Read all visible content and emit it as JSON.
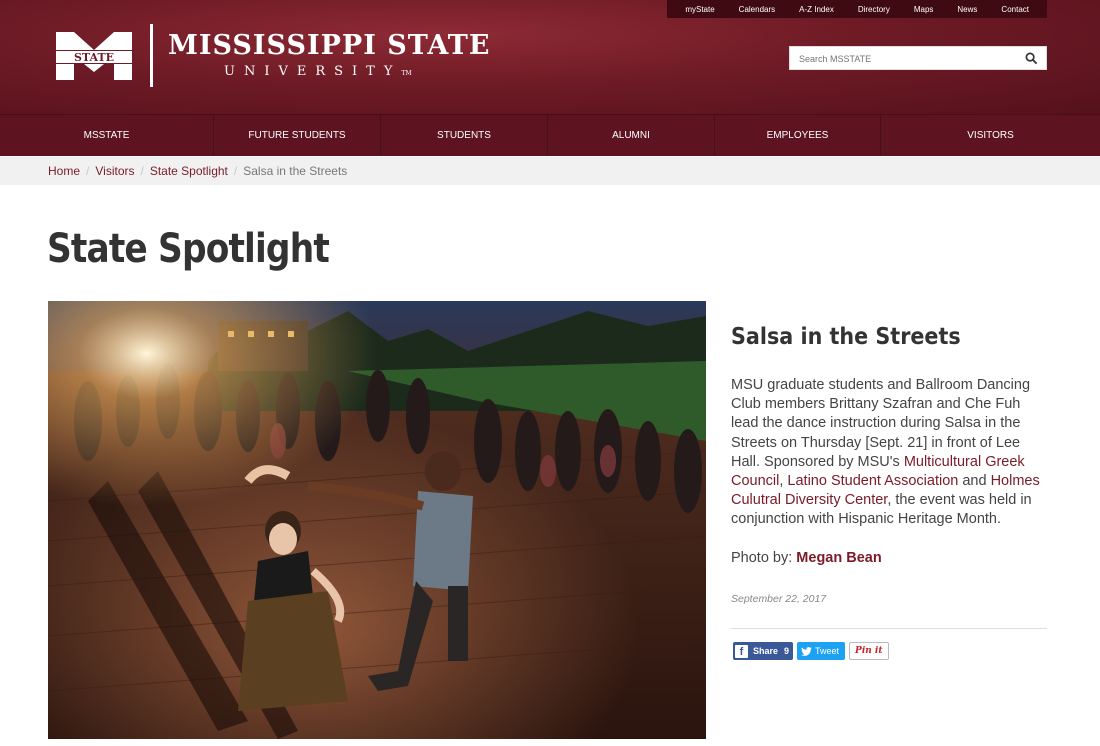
{
  "utility_nav": [
    "myState",
    "Calendars",
    "A-Z Index",
    "Directory",
    "Maps",
    "News",
    "Contact"
  ],
  "logo": {
    "mark_text": "STATE",
    "name": "MISSISSIPPI STATE",
    "sub": "UNIVERSITY",
    "tm": "TM"
  },
  "search": {
    "placeholder": "Search MSSTATE"
  },
  "main_nav": [
    "MSSTATE",
    "FUTURE STUDENTS",
    "STUDENTS",
    "ALUMNI",
    "EMPLOYEES",
    "VISITORS"
  ],
  "breadcrumb": {
    "items": [
      "Home",
      "Visitors",
      "State Spotlight"
    ],
    "current": "Salsa in the Streets"
  },
  "page_title": "State Spotlight",
  "article": {
    "title": "Salsa in the Streets",
    "body_1": "MSU graduate students and Ballroom Dancing Club members Brittany Szafran and Che Fuh lead the dance instruction during Salsa in the Streets on Thursday [Sept. 21] in front of Lee Hall. Sponsored by MSU's ",
    "link_1": "Multicultural Greek Council",
    "body_2": ", ",
    "link_2": "Latino Student Association",
    "body_3": " and ",
    "link_3": "Holmes Culutral Diversity Center",
    "body_4": ", the event was held in conjunction with Hispanic Heritage Month.",
    "photo_by_label": "Photo by: ",
    "photo_by_name": "Megan Bean",
    "date": "September 22, 2017"
  },
  "share": {
    "facebook_label": "Share",
    "facebook_count": "9",
    "twitter_label": "Tweet",
    "pinterest_label": "Pin it"
  },
  "colors": {
    "maroon": "#5d1420",
    "link": "#7a1b28"
  }
}
